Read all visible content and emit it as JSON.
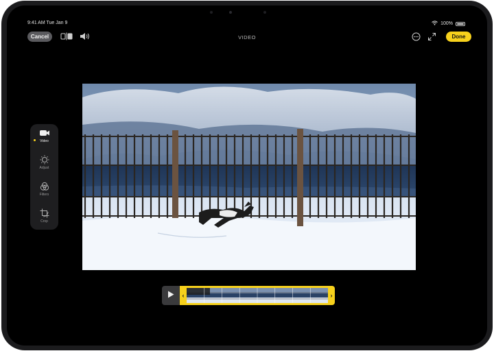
{
  "status_bar": {
    "time_date": "9:41 AM  Tue Jan 9",
    "battery_text": "100%"
  },
  "toolbar": {
    "cancel_label": "Cancel",
    "mode_title": "VIDEO",
    "done_label": "Done",
    "left_icons": [
      "compare-icon",
      "speaker-icon"
    ],
    "right_icons": [
      "more-options-icon",
      "expand-icon"
    ]
  },
  "sidebar": {
    "items": [
      {
        "label": "Video",
        "icon": "video-camera-icon",
        "active": true
      },
      {
        "label": "Adjust",
        "icon": "adjust-dial-icon",
        "active": false
      },
      {
        "label": "Filters",
        "icon": "filters-icon",
        "active": false
      },
      {
        "label": "Crop",
        "icon": "crop-icon",
        "active": false
      }
    ]
  },
  "timeline": {
    "play_icon": "play-icon",
    "handles": [
      "chevron-left-icon",
      "chevron-right-icon"
    ],
    "trim_handle_left_glyph": "‹",
    "trim_handle_right_glyph": "›",
    "frame_count": 8
  },
  "colors": {
    "accent": "#f7d11c",
    "background": "#000000",
    "button_gray": "#5a5a5e"
  }
}
